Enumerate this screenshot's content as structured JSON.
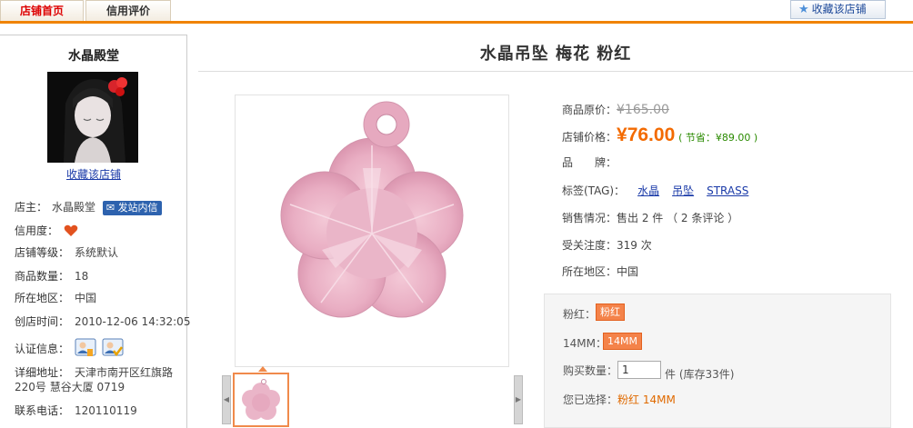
{
  "nav": {
    "tabs": [
      "店铺首页",
      "信用评价"
    ],
    "fav_button": "收藏该店铺"
  },
  "sidebar": {
    "shop_name": "水晶殿堂",
    "fav_link": "收藏该店铺",
    "owner_label": "店主：",
    "owner_value": "水晶殿堂",
    "message_button": "发站内信",
    "credit_label": "信用度：",
    "level_label": "店铺等级：",
    "level_value": "系统默认",
    "count_label": "商品数量：",
    "count_value": "18",
    "region_label": "所在地区：",
    "region_value": "中国",
    "created_label": "创店时间：",
    "created_value": "2010-12-06 14:32:05",
    "cert_label": "认证信息：",
    "address_label": "详细地址：",
    "address_line1": "天津市南开区红旗路",
    "address_line2": "220号  慧谷大厦  0719",
    "phone_label": "联系电话：",
    "phone_value": "120110119"
  },
  "product": {
    "title": "水晶吊坠  梅花  粉红",
    "orig_price_label": "商品原价：",
    "orig_price": "¥165.00",
    "price_label": "店铺价格：",
    "price": "¥76.00",
    "save_text": "( 节省：¥89.00 )",
    "brand_label": "品　　牌：",
    "tag_label": "标签(TAG)：",
    "tags": [
      "水晶",
      "吊坠",
      "STRASS"
    ],
    "sales_label": "销售情况：",
    "sales_value": "售出  2 件  （ 2 条评论 ）",
    "attention_label": "受关注度：",
    "attention_value": "319 次",
    "region_label": "所在地区：",
    "region_value": "中国"
  },
  "sku": {
    "color_label": "粉红：",
    "color_option": "粉红",
    "size_label": "14MM：",
    "size_option": "14MM",
    "qty_label": "购买数量：",
    "qty_value": "1",
    "qty_unit": "件  (库存33件)",
    "chosen_label": "您已选择：",
    "chosen_value": "粉红  14MM"
  },
  "colors": {
    "accent": "#f08300",
    "price": "#f36a00",
    "link": "#1a3aa8",
    "option": "#f4834a"
  }
}
